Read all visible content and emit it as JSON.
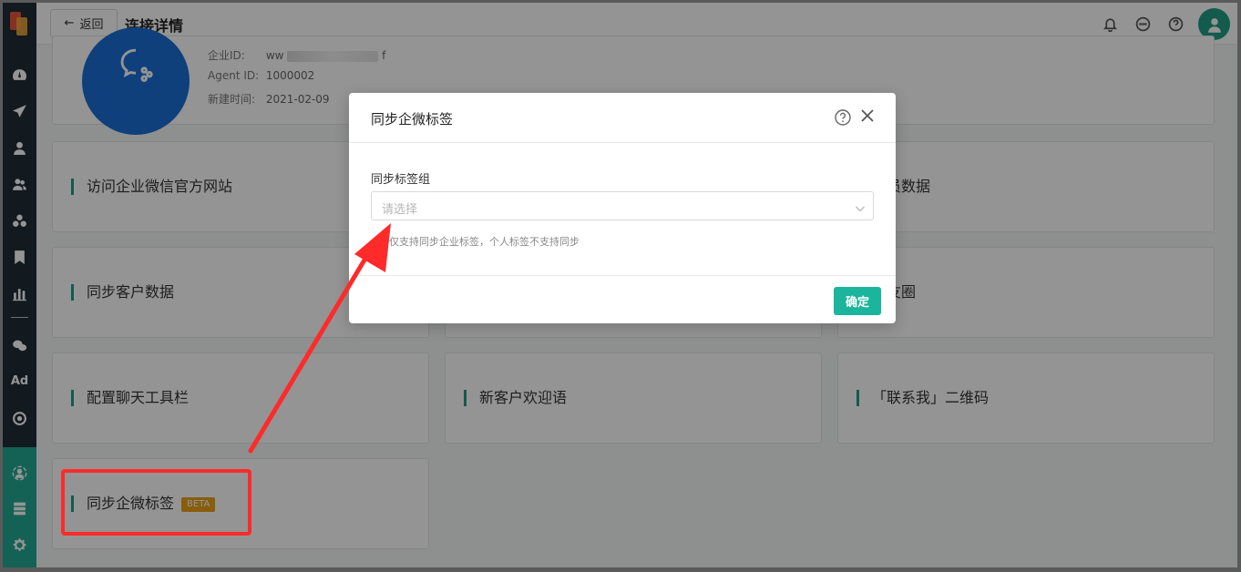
{
  "header": {
    "back_label": "返回",
    "title": "连接详情"
  },
  "info": {
    "corp_id_label": "企业ID:",
    "corp_id_value_start": "ww",
    "corp_id_value_end": "f",
    "agent_id_label": "Agent ID:",
    "agent_id_value": "1000002",
    "created_label": "新建时间:",
    "created_value": "2021-02-09"
  },
  "cards": [
    {
      "label": "访问企业微信官方网站"
    },
    {
      "label": "成员数据"
    },
    {
      "label": "同步客户数据"
    },
    {
      "label": "朋友圈"
    },
    {
      "label": "配置聊天工具栏"
    },
    {
      "label": "新客户欢迎语"
    },
    {
      "label": "「联系我」二维码"
    },
    {
      "label": "同步企微标签",
      "badge": "BETA"
    }
  ],
  "modal": {
    "title": "同步企微标签",
    "field_label": "同步标签组",
    "select_placeholder": "请选择",
    "hint": "仅支持同步企业标签，个人标签不支持同步",
    "ok_label": "确定"
  },
  "sidebar": {
    "items": [
      "dashboard-icon",
      "send-icon",
      "user-icon",
      "users-icon",
      "cluster-icon",
      "bookmark-icon",
      "chart-icon",
      "wechat-icon",
      "ad-icon",
      "target-icon",
      "team-icon",
      "server-icon",
      "settings-icon"
    ],
    "ad_text": "Ad"
  },
  "colors": {
    "accent": "#1bb49c",
    "sidebar_bg": "#1f2b36",
    "annotation": "#ff2a2a",
    "beta": "#e8a317"
  }
}
